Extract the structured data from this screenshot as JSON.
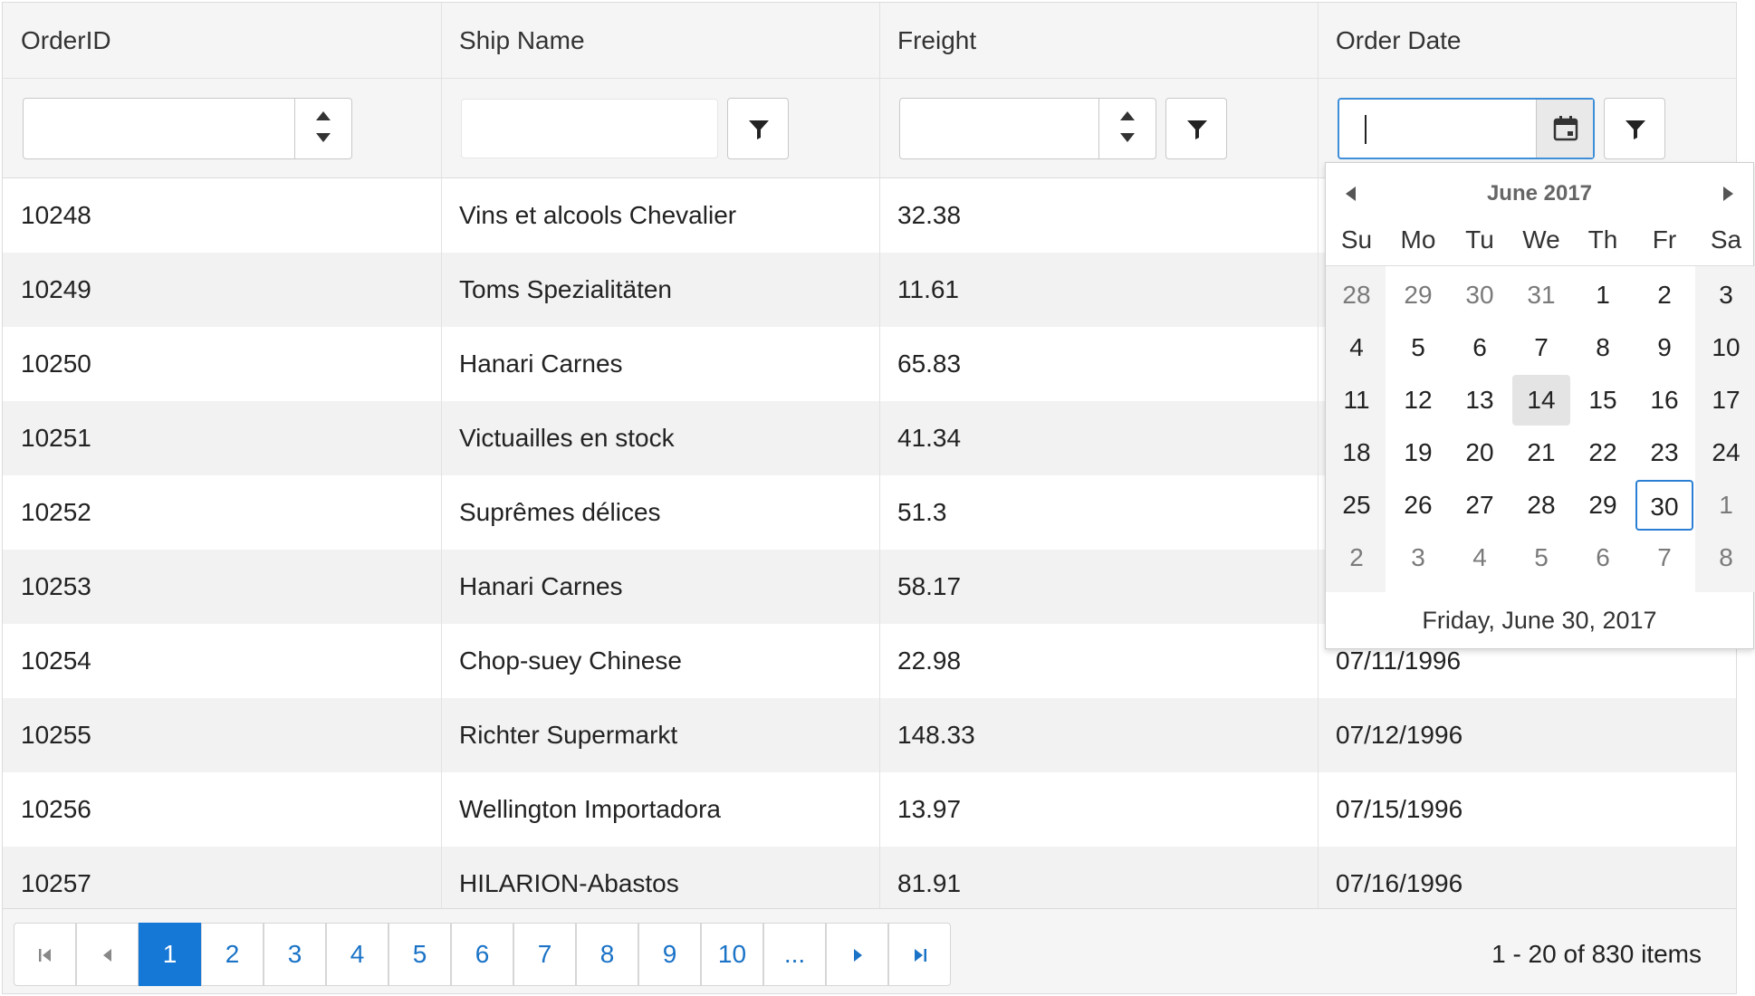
{
  "columns": [
    {
      "key": "order_id",
      "label": "OrderID"
    },
    {
      "key": "ship_name",
      "label": "Ship Name"
    },
    {
      "key": "freight",
      "label": "Freight"
    },
    {
      "key": "order_date",
      "label": "Order Date"
    }
  ],
  "icons": {
    "spinner_up": "triangle-up-icon",
    "spinner_down": "triangle-down-icon",
    "filter": "funnel-icon",
    "calendar": "calendar-icon",
    "first": "first-page-icon",
    "prev": "previous-page-icon",
    "next": "next-page-icon",
    "last": "last-page-icon"
  },
  "colors": {
    "accent": "#1578d6",
    "selected_border": "#2a7fd4",
    "alt_row": "#f2f2f2"
  },
  "rows": [
    {
      "order_id": "10248",
      "ship_name": "Vins et alcools Chevalier",
      "freight": "32.38",
      "order_date": ""
    },
    {
      "order_id": "10249",
      "ship_name": "Toms Spezialitäten",
      "freight": "11.61",
      "order_date": ""
    },
    {
      "order_id": "10250",
      "ship_name": "Hanari Carnes",
      "freight": "65.83",
      "order_date": ""
    },
    {
      "order_id": "10251",
      "ship_name": "Victuailles en stock",
      "freight": "41.34",
      "order_date": ""
    },
    {
      "order_id": "10252",
      "ship_name": "Suprêmes délices",
      "freight": "51.3",
      "order_date": ""
    },
    {
      "order_id": "10253",
      "ship_name": "Hanari Carnes",
      "freight": "58.17",
      "order_date": ""
    },
    {
      "order_id": "10254",
      "ship_name": "Chop-suey Chinese",
      "freight": "22.98",
      "order_date": "07/11/1996"
    },
    {
      "order_id": "10255",
      "ship_name": "Richter Supermarkt",
      "freight": "148.33",
      "order_date": "07/12/1996"
    },
    {
      "order_id": "10256",
      "ship_name": "Wellington Importadora",
      "freight": "13.97",
      "order_date": "07/15/1996"
    },
    {
      "order_id": "10257",
      "ship_name": "HILARION-Abastos",
      "freight": "81.91",
      "order_date": "07/16/1996"
    }
  ],
  "pager": {
    "pages": [
      "1",
      "2",
      "3",
      "4",
      "5",
      "6",
      "7",
      "8",
      "9",
      "10",
      "..."
    ],
    "current": "1",
    "info": "1 - 20 of 830 items"
  },
  "calendar": {
    "title": "June 2017",
    "weekdays": [
      "Su",
      "Mo",
      "Tu",
      "We",
      "Th",
      "Fr",
      "Sa"
    ],
    "weeks": [
      [
        "28",
        "29",
        "30",
        "31",
        "1",
        "2",
        "3"
      ],
      [
        "4",
        "5",
        "6",
        "7",
        "8",
        "9",
        "10"
      ],
      [
        "11",
        "12",
        "13",
        "14",
        "15",
        "16",
        "17"
      ],
      [
        "18",
        "19",
        "20",
        "21",
        "22",
        "23",
        "24"
      ],
      [
        "25",
        "26",
        "27",
        "28",
        "29",
        "30",
        "1"
      ],
      [
        "2",
        "3",
        "4",
        "5",
        "6",
        "7",
        "8"
      ]
    ],
    "other_month": [
      [
        0,
        0
      ],
      [
        0,
        1
      ],
      [
        0,
        2
      ],
      [
        0,
        3
      ],
      [
        4,
        6
      ],
      [
        5,
        0
      ],
      [
        5,
        1
      ],
      [
        5,
        2
      ],
      [
        5,
        3
      ],
      [
        5,
        4
      ],
      [
        5,
        5
      ],
      [
        5,
        6
      ]
    ],
    "today": [
      2,
      3
    ],
    "selected": [
      4,
      5
    ],
    "footer": "Friday, June 30, 2017"
  }
}
